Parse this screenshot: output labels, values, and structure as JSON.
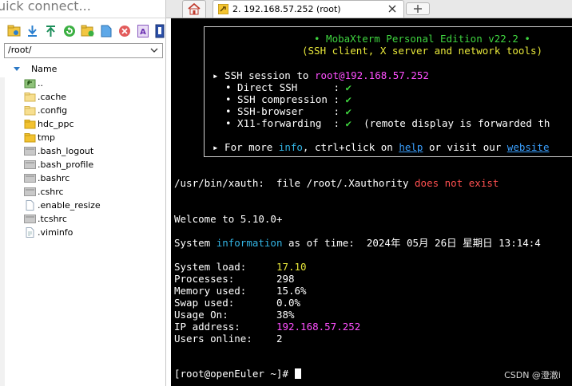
{
  "quick_connect": {
    "text": "uick connect..."
  },
  "toolbar": {
    "icons": [
      "home-folder-icon",
      "download-icon",
      "upload-icon",
      "refresh-icon",
      "new-folder-icon",
      "new-file-icon",
      "delete-icon",
      "rename-icon",
      "settings-icon"
    ]
  },
  "path_box": {
    "value": "/root/"
  },
  "tree": {
    "header": "Name",
    "items": [
      {
        "name": "..",
        "type": "parent"
      },
      {
        "name": ".cache",
        "type": "folder-light"
      },
      {
        "name": ".config",
        "type": "folder-light"
      },
      {
        "name": "hdc_ppc",
        "type": "folder"
      },
      {
        "name": "tmp",
        "type": "folder"
      },
      {
        "name": ".bash_logout",
        "type": "file-gray"
      },
      {
        "name": ".bash_profile",
        "type": "file-gray"
      },
      {
        "name": ".bashrc",
        "type": "file-gray"
      },
      {
        "name": ".cshrc",
        "type": "file-gray"
      },
      {
        "name": ".enable_resize",
        "type": "file-blank"
      },
      {
        "name": ".tcshrc",
        "type": "file-gray"
      },
      {
        "name": ".viminfo",
        "type": "file-text"
      }
    ]
  },
  "tabs": {
    "session_label": "2. 192.168.57.252 (root)"
  },
  "terminal": {
    "banner_title": "• MobaXterm Personal Edition v22.2 •",
    "banner_subtitle": "(SSH client, X server and network tools)",
    "ssh_prefix": "▸ SSH session to ",
    "ssh_target": "root@192.168.57.252",
    "features": [
      {
        "label": "• Direct SSH      :",
        "mark": "✔",
        "note": ""
      },
      {
        "label": "• SSH compression :",
        "mark": "✔",
        "note": ""
      },
      {
        "label": "• SSH-browser     :",
        "mark": "✔",
        "note": ""
      },
      {
        "label": "• X11-forwarding  :",
        "mark": "✔",
        "note": "(remote display is forwarded th"
      }
    ],
    "info_line": {
      "a": "▸ For more ",
      "info": "info",
      "b": ", ctrl+click on ",
      "help": "help",
      "c": " or visit our ",
      "website": "website"
    },
    "xauth_a": "/usr/bin/xauth:  file /root/.Xauthority ",
    "xauth_b": "does not exist",
    "welcome": "Welcome to 5.10.0+",
    "sysinfo_a": "System ",
    "sysinfo_b": "information",
    "sysinfo_c": " as of time:  2024年 05月 26日 星期日 13:14:4",
    "stats": [
      {
        "label": "System load:     ",
        "value": "17.10",
        "color": "yellow"
      },
      {
        "label": "Processes:       ",
        "value": "298",
        "color": "white"
      },
      {
        "label": "Memory used:     ",
        "value": "15.6%",
        "color": "white"
      },
      {
        "label": "Swap used:       ",
        "value": "0.0%",
        "color": "white"
      },
      {
        "label": "Usage On:        ",
        "value": "38%",
        "color": "white"
      },
      {
        "label": "IP address:      ",
        "value": "192.168.57.252",
        "color": "pink"
      },
      {
        "label": "Users online:    ",
        "value": "2",
        "color": "white"
      }
    ],
    "prompt": "[root@openEuler ~]# "
  },
  "watermark": "CSDN @澄澈i"
}
